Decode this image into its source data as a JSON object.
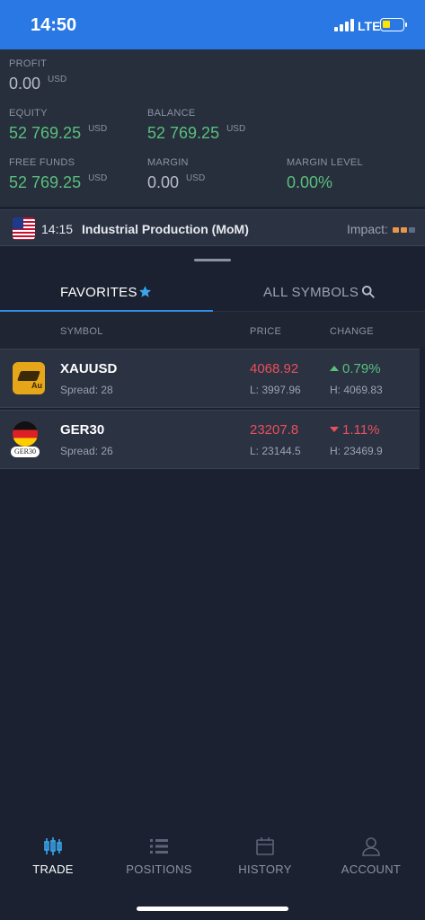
{
  "status_bar": {
    "time": "14:50",
    "network": "LTE"
  },
  "account": {
    "profit": {
      "label": "PROFIT",
      "value": "0.00",
      "currency": "USD"
    },
    "equity": {
      "label": "EQUITY",
      "value": "52 769.25",
      "currency": "USD"
    },
    "balance": {
      "label": "BALANCE",
      "value": "52 769.25",
      "currency": "USD"
    },
    "free_funds": {
      "label": "FREE FUNDS",
      "value": "52 769.25",
      "currency": "USD"
    },
    "margin": {
      "label": "MARGIN",
      "value": "0.00",
      "currency": "USD"
    },
    "margin_level": {
      "label": "MARGIN LEVEL",
      "value": "0.00%"
    }
  },
  "news": {
    "time": "14:15",
    "title": "Industrial Production (MoM)",
    "impact_label": "Impact:",
    "impact_level": 2,
    "impact_max": 3
  },
  "tabs": {
    "favorites": "FAVORITES",
    "all_symbols": "ALL SYMBOLS"
  },
  "table": {
    "headers": {
      "symbol": "SYMBOL",
      "price": "PRICE",
      "change": "CHANGE"
    },
    "rows": [
      {
        "symbol": "XAUUSD",
        "spread": "Spread: 28",
        "price": "4068.92",
        "low": "L: 3997.96",
        "change": "0.79%",
        "direction": "up",
        "high": "H: 4069.83",
        "icon_text": "Au"
      },
      {
        "symbol": "GER30",
        "spread": "Spread: 26",
        "price": "23207.8",
        "low": "L: 23144.5",
        "change": "1.11%",
        "direction": "down",
        "high": "H: 23469.9",
        "icon_text": "GER30"
      }
    ]
  },
  "nav": [
    {
      "label": "TRADE",
      "icon": "candlestick-chart-icon",
      "active": true
    },
    {
      "label": "POSITIONS",
      "icon": "list-icon",
      "active": false
    },
    {
      "label": "HISTORY",
      "icon": "calendar-icon",
      "active": false
    },
    {
      "label": "ACCOUNT",
      "icon": "person-icon",
      "active": false
    }
  ],
  "colors": {
    "accent": "#2f8fe6",
    "positive": "#59c07c",
    "negative": "#ea4f5c",
    "impact_active": "#e8964a",
    "impact_inactive": "#5f6b85"
  }
}
